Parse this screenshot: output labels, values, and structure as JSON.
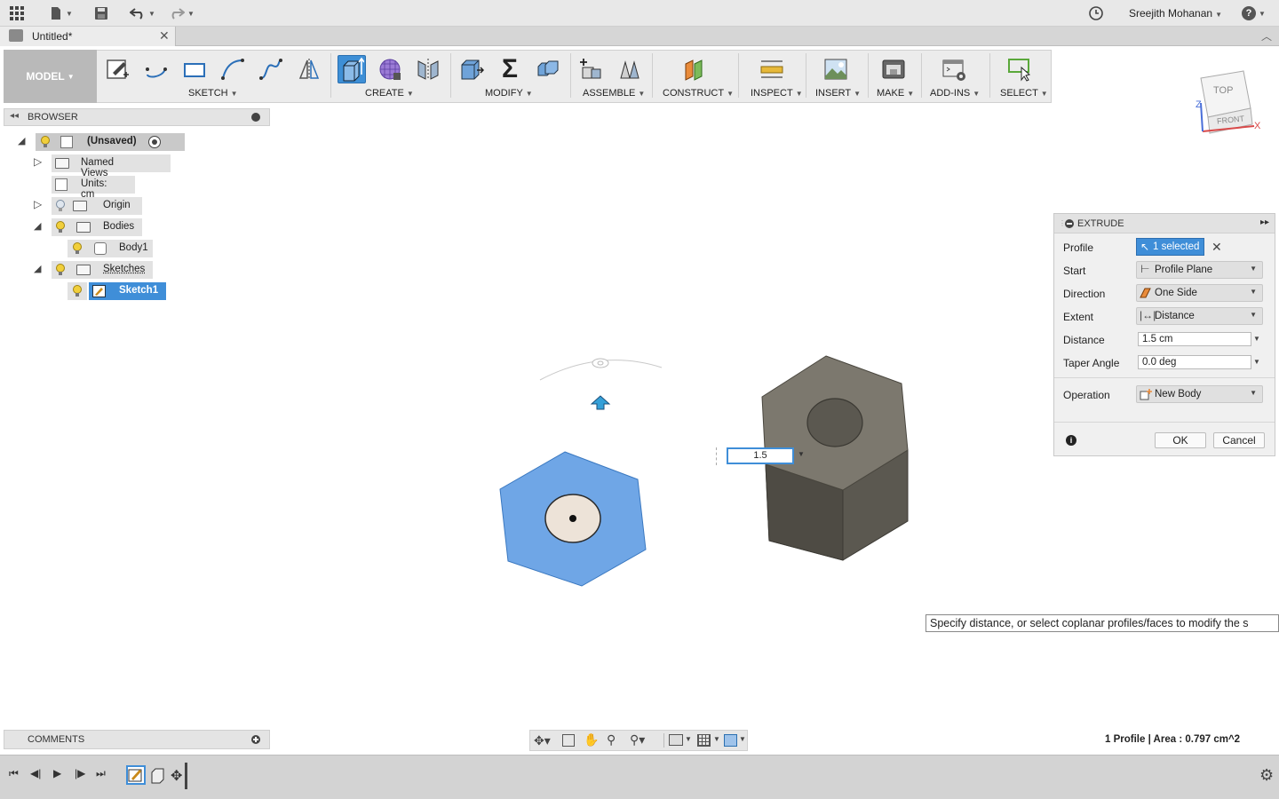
{
  "app": {
    "user_name": "Sreejith Mohanan",
    "help_label": "?"
  },
  "tab": {
    "title": "Untitled*",
    "close": "✕"
  },
  "toolbar": {
    "workspace": "MODEL",
    "groups": {
      "sketch": "SKETCH",
      "create": "CREATE",
      "modify": "MODIFY",
      "assemble": "ASSEMBLE",
      "construct": "CONSTRUCT",
      "inspect": "INSPECT",
      "insert": "INSERT",
      "make": "MAKE",
      "addins": "ADD-INS",
      "select": "SELECT"
    }
  },
  "viewcube": {
    "top": "TOP",
    "front": "FRONT",
    "axis_x": "X",
    "axis_z": "Z"
  },
  "browser": {
    "title": "BROWSER",
    "root": "(Unsaved)",
    "named_views": "Named Views",
    "units": "Units: cm",
    "origin": "Origin",
    "bodies": "Bodies",
    "body1": "Body1",
    "sketches": "Sketches",
    "sketch1": "Sketch1"
  },
  "extrude": {
    "title": "EXTRUDE",
    "profile_label": "Profile",
    "profile_value": "1 selected",
    "start_label": "Start",
    "start_value": "Profile Plane",
    "direction_label": "Direction",
    "direction_value": "One Side",
    "extent_label": "Extent",
    "extent_value": "Distance",
    "distance_label": "Distance",
    "distance_value": "1.5 cm",
    "taper_label": "Taper Angle",
    "taper_value": "0.0 deg",
    "operation_label": "Operation",
    "operation_value": "New Body",
    "ok": "OK",
    "cancel": "Cancel"
  },
  "canvas": {
    "distance_input": "1.5",
    "tooltip": "Specify distance, or select coplanar profiles/faces to modify the s"
  },
  "comments": {
    "title": "COMMENTS"
  },
  "status": {
    "text": "1 Profile | Area : 0.797 cm^2"
  },
  "colors": {
    "accent": "#3f8ed8",
    "profile_fill": "#6fa6e6",
    "body_dark": "#5b5850",
    "body_light": "#7c786e"
  }
}
